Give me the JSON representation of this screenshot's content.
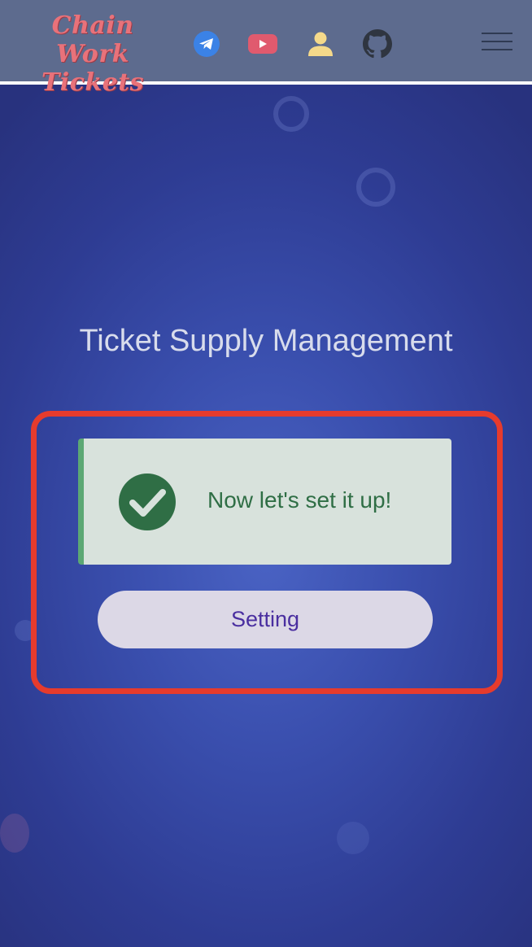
{
  "header": {
    "logo_line1": "Chain Work",
    "logo_line2": "Tickets",
    "icons": [
      "telegram-icon",
      "youtube-icon",
      "user-icon",
      "github-icon",
      "hamburger-menu-icon"
    ]
  },
  "main": {
    "title": "Ticket Supply Management",
    "alert": {
      "message": "Now let's set it up!",
      "status": "success"
    },
    "setting_button_label": "Setting"
  },
  "colors": {
    "header_bg": "#5d6b8e",
    "logo": "#e8727a",
    "background": "#3a4fae",
    "alert_bg": "#d8e2dc",
    "alert_text": "#2f6e45",
    "highlight_border": "#e63b2d",
    "button_text": "#4a2fa0"
  }
}
